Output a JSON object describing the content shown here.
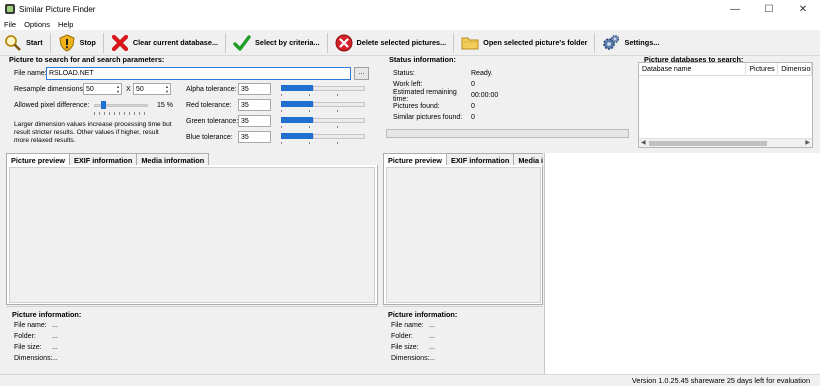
{
  "window": {
    "title": "Similar Picture Finder",
    "minimize": "—",
    "maximize": "☐",
    "close": "✕"
  },
  "menu": [
    "File",
    "Options",
    "Help"
  ],
  "toolbar": {
    "start": "Start",
    "stop": "Stop",
    "clear": "Clear current database...",
    "select": "Select by criteria...",
    "delete": "Delete selected pictures...",
    "open_folder": "Open selected picture's folder",
    "settings": "Settings..."
  },
  "search": {
    "heading": "Picture to search for and search parameters:",
    "file_name_label": "File name:",
    "file_name_value": "RSLOAD.NET",
    "browse": "...",
    "resample_label": "Resample dimensions:",
    "resample_w": "50",
    "resample_x": "X",
    "resample_h": "50",
    "pixel_diff_label": "Allowed pixel difference:",
    "pixel_diff_value": "15 %",
    "pixel_diff_level": 0.15,
    "note": "Larger dimension values increase processing time but result stricter results. Other values if higher, result more relaxed results.",
    "alpha_label": "Alpha tolerance:",
    "alpha_value": "35",
    "red_label": "Red tolerance:",
    "red_value": "35",
    "green_label": "Green tolerance:",
    "green_value": "35",
    "blue_label": "Blue tolerance:",
    "blue_value": "35"
  },
  "status": {
    "heading": "Status information:",
    "status_label": "Status:",
    "status_value": "Ready.",
    "work_left_label": "Work left:",
    "work_left_value": "0",
    "remaining_label": "Estimated remaining time:",
    "remaining_value": "00:00:00",
    "found_label": "Pictures found:",
    "found_value": "0",
    "similar_label": "Similar pictures found:",
    "similar_value": "0",
    "progress": 0
  },
  "databases": {
    "heading": "Picture databases to search:",
    "col_name": "Database name",
    "col_pictures": "Pictures",
    "col_dimensions": "Dimensions"
  },
  "left_panel": {
    "tabs": [
      "Picture preview",
      "EXIF information",
      "Media information"
    ],
    "info_heading": "Picture information:",
    "file_name_label": "File name:",
    "file_name_value": "...",
    "folder_label": "Folder:",
    "folder_value": "...",
    "file_size_label": "File size:",
    "file_size_value": "...",
    "dimensions_label": "Dimensions:",
    "dimensions_value": "..."
  },
  "right_panel": {
    "tabs": [
      "Picture preview",
      "EXIF information",
      "Media infor"
    ],
    "info_heading": "Picture information:",
    "file_name_label": "File name:",
    "file_name_value": "...",
    "folder_label": "Folder:",
    "folder_value": "...",
    "file_size_label": "File size:",
    "file_size_value": "...",
    "dimensions_label": "Dimensions:",
    "dimensions_value": "..."
  },
  "statusbar": "Version 1.0.25.45 shareware 25 days left for evaluation"
}
